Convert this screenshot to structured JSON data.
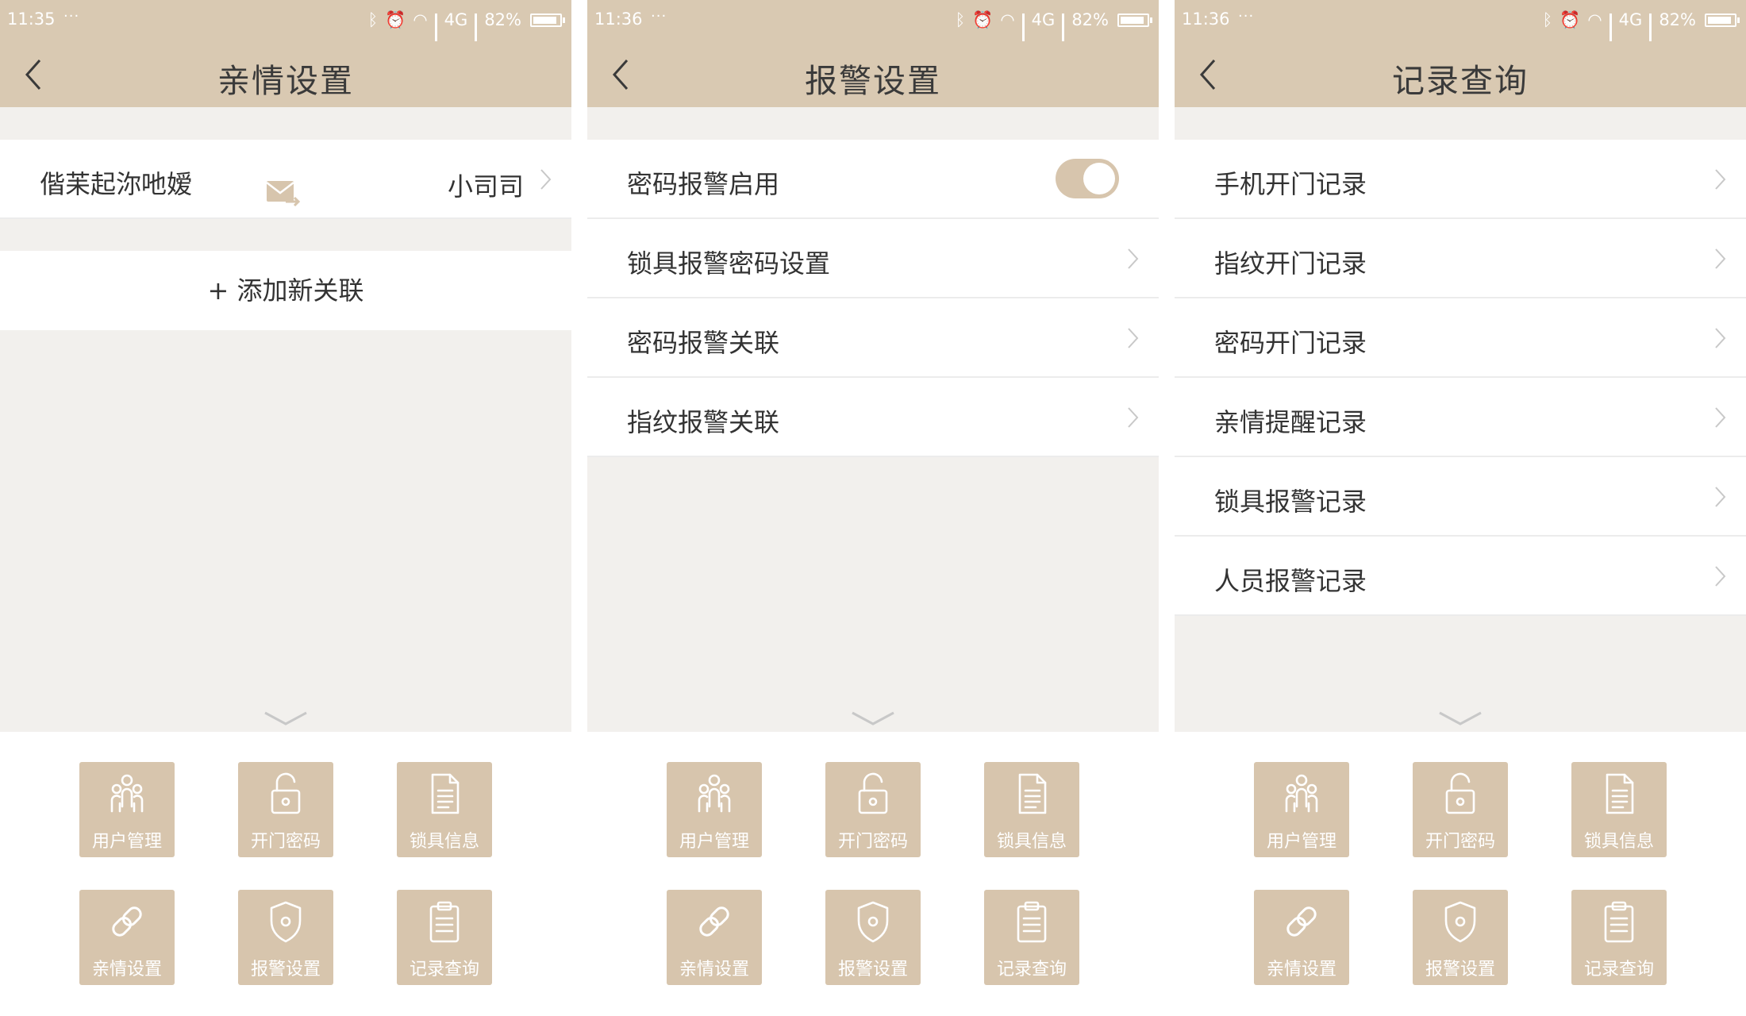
{
  "status_bars": [
    {
      "time": "11:35",
      "dots": "···",
      "network": "4G",
      "battery": "82%"
    },
    {
      "time": "11:36",
      "dots": "···",
      "network": "4G",
      "battery": "82%"
    },
    {
      "time": "11:36",
      "dots": "···",
      "network": "4G",
      "battery": "82%"
    }
  ],
  "screens": {
    "family": {
      "title": "亲情设置",
      "contact": {
        "name": "偕苿起沵吔嫒",
        "value": "小司司"
      },
      "add_label": "+ 添加新关联"
    },
    "alarm": {
      "title": "报警设置",
      "rows": [
        {
          "label": "密码报警启用",
          "toggle_on": true
        },
        {
          "label": "锁具报警密码设置"
        },
        {
          "label": "密码报警关联"
        },
        {
          "label": "指纹报警关联"
        }
      ]
    },
    "records": {
      "title": "记录查询",
      "rows": [
        {
          "label": "手机开门记录"
        },
        {
          "label": "指纹开门记录"
        },
        {
          "label": "密码开门记录"
        },
        {
          "label": "亲情提醒记录"
        },
        {
          "label": "锁具报警记录"
        },
        {
          "label": "人员报警记录"
        }
      ]
    }
  },
  "menu": [
    {
      "label": "用户管理",
      "icon": "users-icon"
    },
    {
      "label": "开门密码",
      "icon": "unlock-icon"
    },
    {
      "label": "锁具信息",
      "icon": "document-icon"
    },
    {
      "label": "亲情设置",
      "icon": "link-icon"
    },
    {
      "label": "报警设置",
      "icon": "shield-icon"
    },
    {
      "label": "记录查询",
      "icon": "clipboard-icon"
    }
  ],
  "colors": {
    "header": "#d9c9b2",
    "tile": "#d7c5ad",
    "background": "#f2f0ed",
    "text": "#333333"
  }
}
